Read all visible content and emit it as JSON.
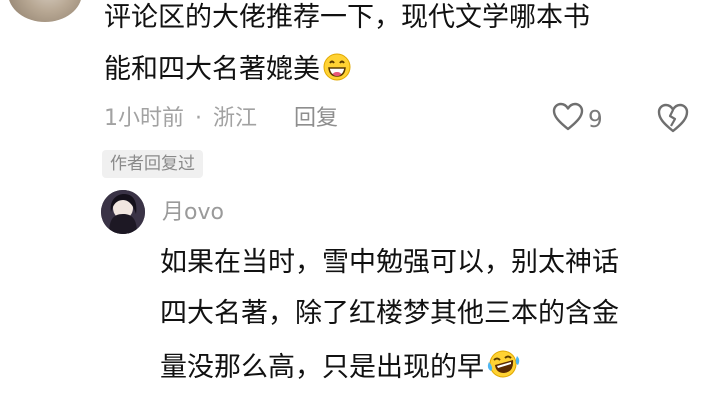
{
  "comment": {
    "lines": [
      "评论区的大佬推荐一下，现代文学哪本书",
      "能和四大名著媲美"
    ],
    "emoji_icon": "grinning-emoji-icon",
    "time": "1小时前",
    "separator": "·",
    "location": "浙江",
    "reply_label": "回复",
    "like_count": "9",
    "like_icon": "heart-outline-icon",
    "dislike_icon": "broken-heart-icon",
    "author_badge": "作者回复过"
  },
  "reply": {
    "username": "月ovo",
    "lines": [
      "如果在当时，雪中勉强可以，别太神话",
      "四大名著，除了红楼梦其他三本的含金",
      "量没那么高，只是出现的早"
    ],
    "emoji_icon": "laughing-tears-emoji-icon"
  },
  "colors": {
    "text": "#111111",
    "meta": "#a2a2a2",
    "badge_bg": "#f0f0f0"
  }
}
